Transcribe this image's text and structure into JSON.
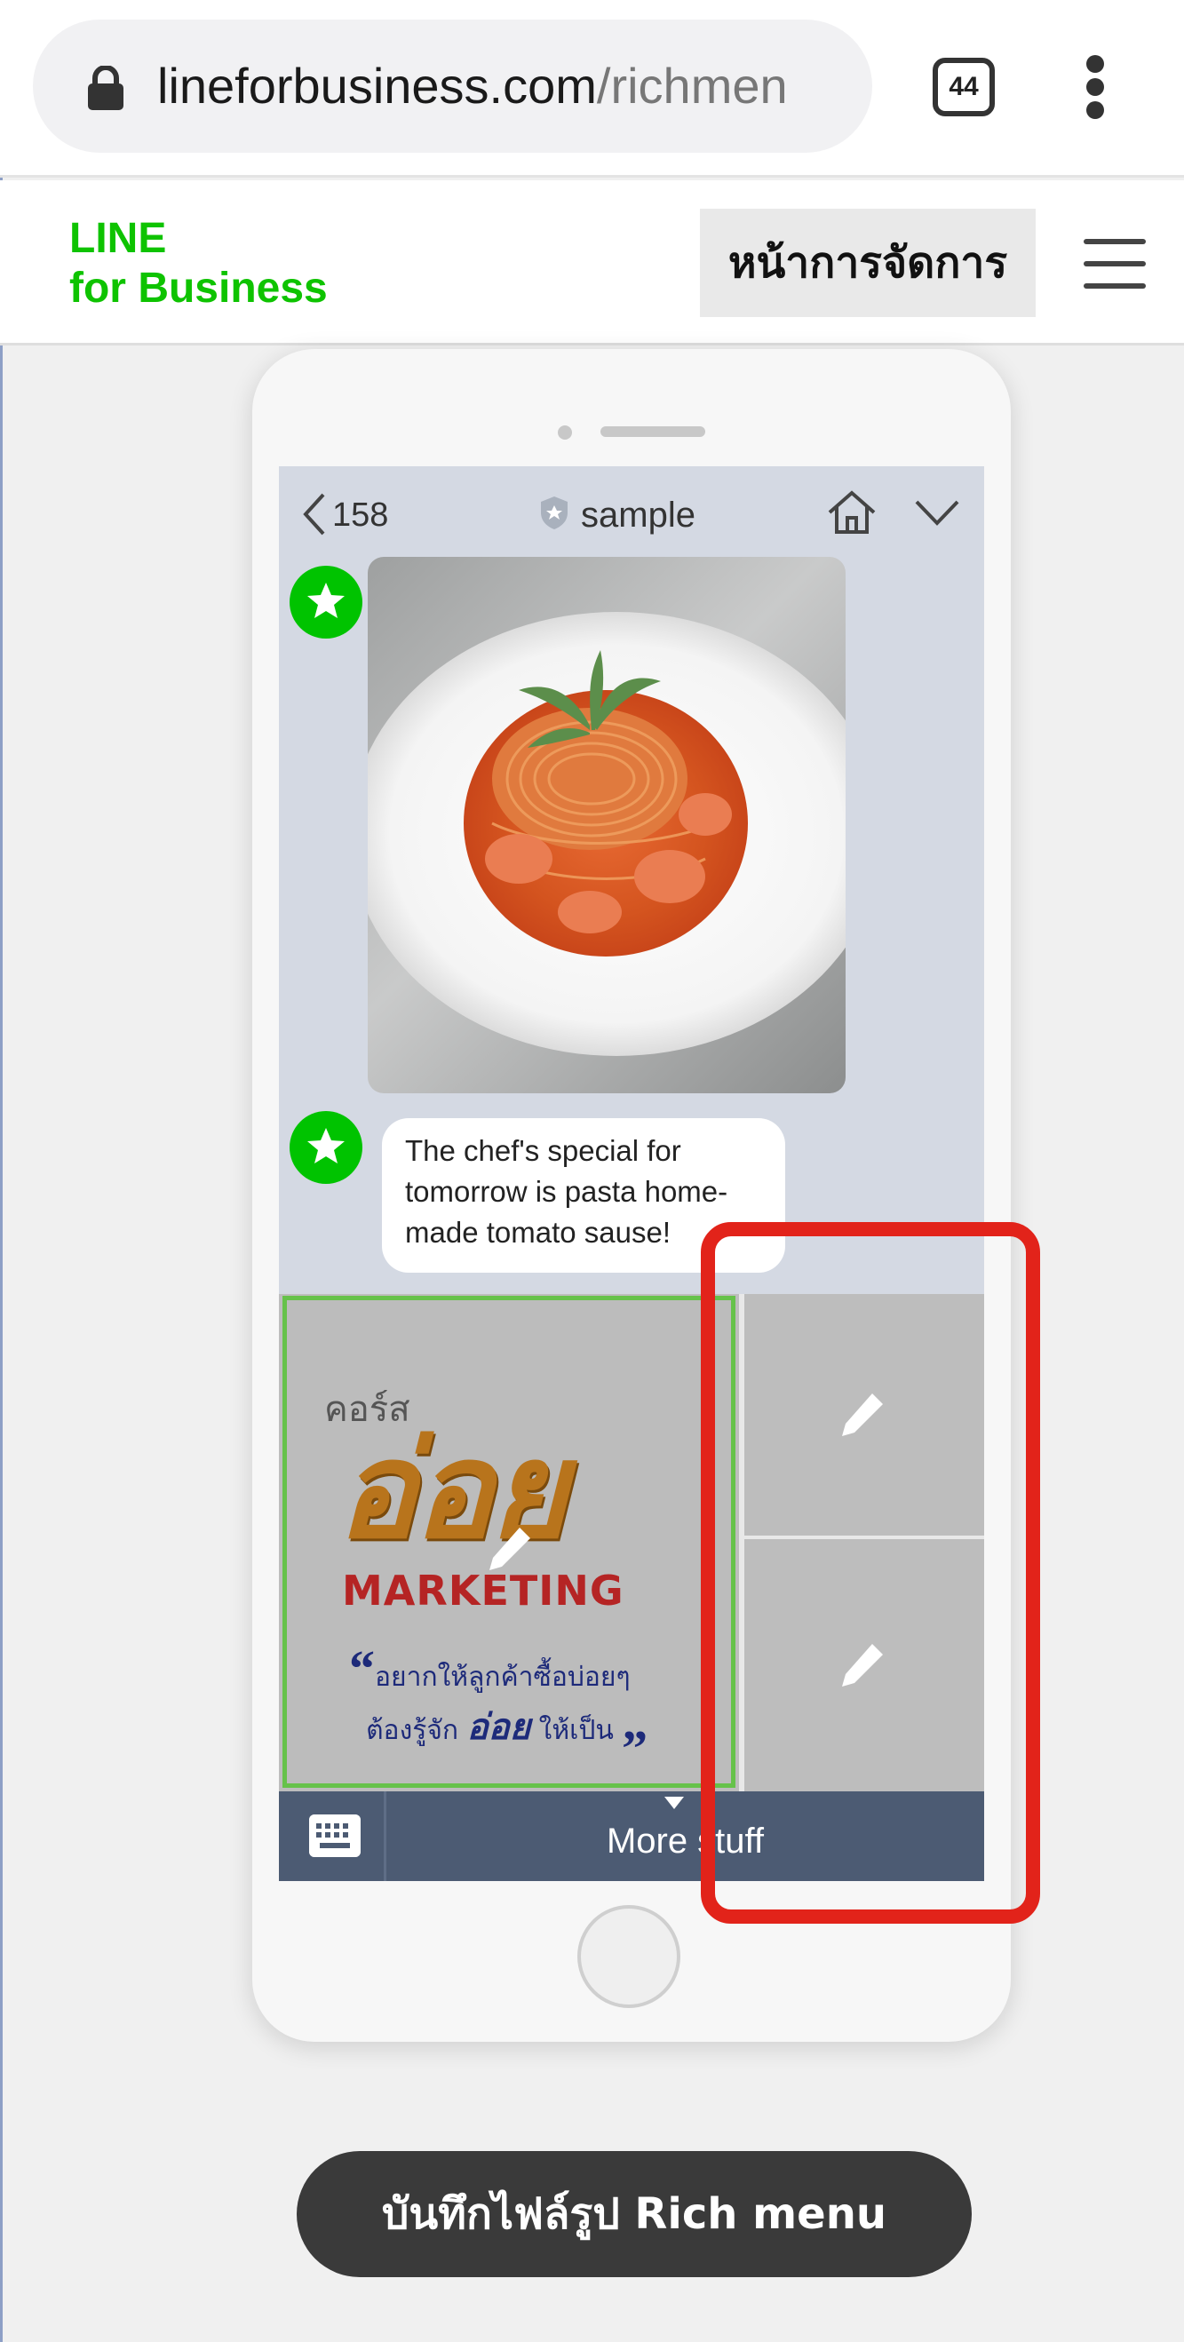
{
  "browser": {
    "url_domain": "lineforbusiness.com",
    "url_path": "/richmen",
    "tab_count": "44",
    "icons": [
      "lock-icon",
      "kebab-menu-icon"
    ]
  },
  "site_header": {
    "logo_line1": "LINE",
    "logo_line2": "for Business",
    "manage_label": "หน้าการจัดการ",
    "menu_icon": "hamburger-menu-icon",
    "brand_color": "#0ec300"
  },
  "chat": {
    "unread_count": "158",
    "name": "sample",
    "message_text": "The chef's special for tomorrow is pasta home-made tomato sause!",
    "screen_bg": "#d4d9e3",
    "avatar_color": "#00c300"
  },
  "rich_menu": {
    "promo_small": "คอร์ส",
    "promo_big": "อ่อย",
    "promo_marketing": "MARKETING",
    "promo_quote_line1": "อยากให้ลูกค้าซื้อบ่อยๆ",
    "promo_quote_line2_pre": "ต้องรู้จัก",
    "promo_quote_line2_bold": "อ่อย",
    "promo_quote_line2_post": "ให้เป็น",
    "quote_open": "“",
    "quote_close": "„",
    "bar_label": "More stuff",
    "bar_color": "#4c5b73",
    "selected_border_color": "#66c24a"
  },
  "highlight_color": "#e2231a",
  "save_button_label": "บันทึกไฟล์รูป Rich menu"
}
